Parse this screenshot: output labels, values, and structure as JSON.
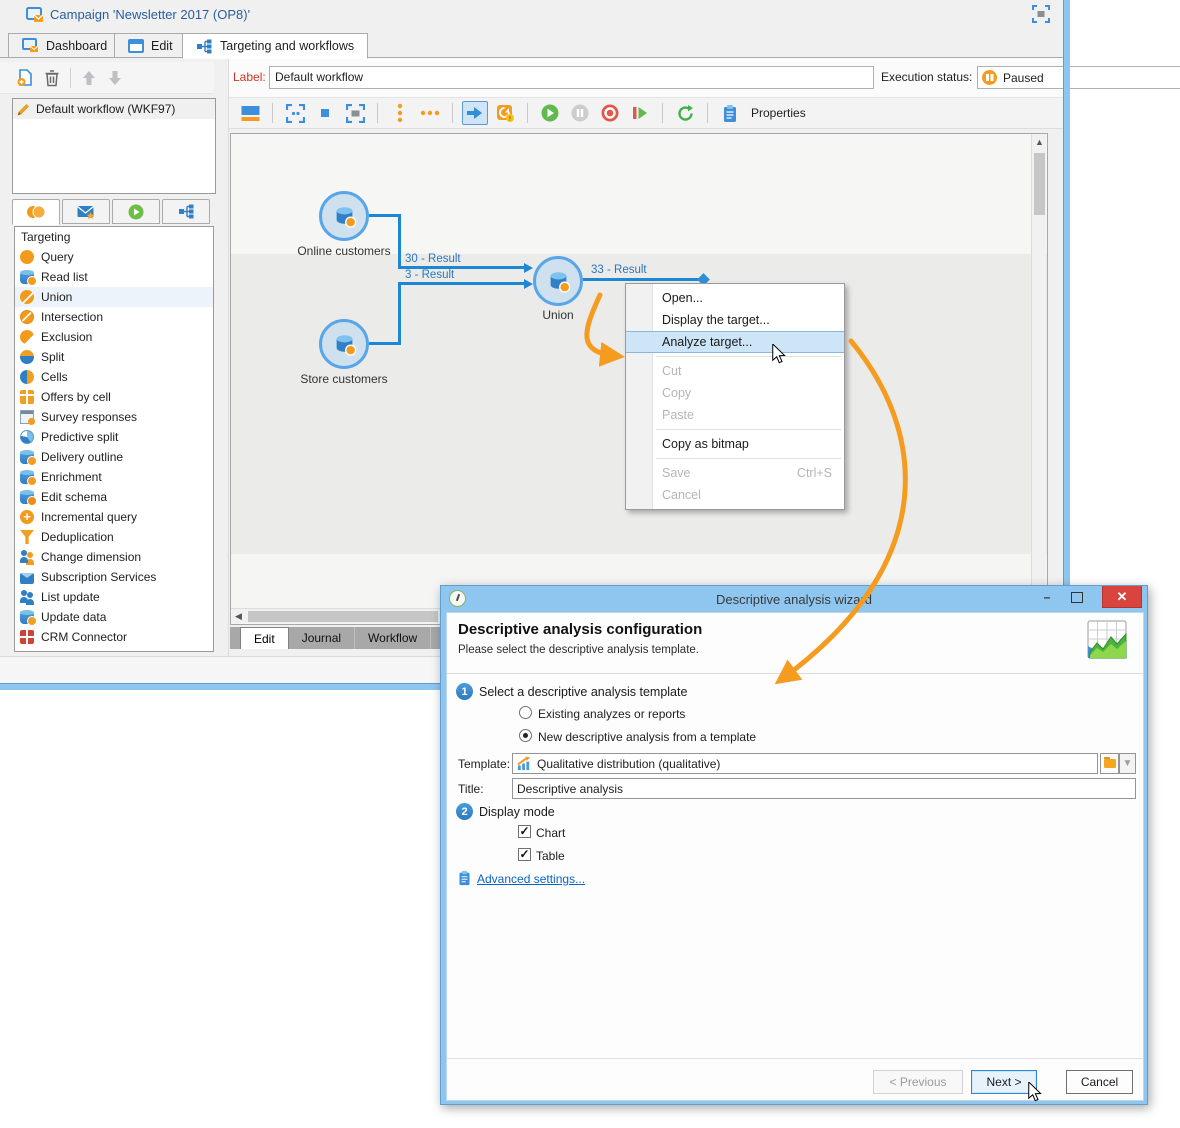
{
  "app": {
    "title": "Campaign 'Newsletter 2017 (OP8)'",
    "tabs": [
      {
        "label": "Dashboard"
      },
      {
        "label": "Edit"
      },
      {
        "label": "Targeting and workflows"
      }
    ]
  },
  "sidebar": {
    "workflows": [
      {
        "label": "Default workflow (WKF97)"
      }
    ],
    "palette": {
      "header": "Targeting",
      "items": [
        {
          "label": "Query",
          "icon": "circle-orange"
        },
        {
          "label": "Read list",
          "icon": "db-person"
        },
        {
          "label": "Union",
          "icon": "circle-union",
          "highlighted": true
        },
        {
          "label": "Intersection",
          "icon": "circle-intersect"
        },
        {
          "label": "Exclusion",
          "icon": "circle-exclude"
        },
        {
          "label": "Split",
          "icon": "split"
        },
        {
          "label": "Cells",
          "icon": "pie"
        },
        {
          "label": "Offers by cell",
          "icon": "offers"
        },
        {
          "label": "Survey responses",
          "icon": "survey"
        },
        {
          "label": "Predictive split",
          "icon": "pie-blue"
        },
        {
          "label": "Delivery outline",
          "icon": "db-mail"
        },
        {
          "label": "Enrichment",
          "icon": "db-star"
        },
        {
          "label": "Edit schema",
          "icon": "db-gear"
        },
        {
          "label": "Incremental query",
          "icon": "circle-plus"
        },
        {
          "label": "Deduplication",
          "icon": "funnel"
        },
        {
          "label": "Change dimension",
          "icon": "people-swap"
        },
        {
          "label": "Subscription Services",
          "icon": "envelope"
        },
        {
          "label": "List update",
          "icon": "people"
        },
        {
          "label": "Update data",
          "icon": "db-refresh"
        },
        {
          "label": "CRM Connector",
          "icon": "crm"
        }
      ]
    }
  },
  "workflow_editor": {
    "label_field": {
      "label": "Label:",
      "value": "Default workflow"
    },
    "execution_status": {
      "label": "Execution status:",
      "value": "Paused"
    },
    "toolbar": {
      "properties_label": "Properties"
    },
    "canvas": {
      "nodes": [
        {
          "label": "Online customers"
        },
        {
          "label": "Store customers"
        },
        {
          "label": "Union"
        }
      ],
      "edges": [
        {
          "label": "30 - Result"
        },
        {
          "label": "3 - Result"
        },
        {
          "label": "33 - Result"
        }
      ]
    },
    "bottom_tabs": [
      {
        "label": "Edit",
        "active": true
      },
      {
        "label": "Journal",
        "active": false
      },
      {
        "label": "Workflow",
        "active": false
      }
    ]
  },
  "context_menu": {
    "items": [
      {
        "label": "Open...",
        "state": "normal"
      },
      {
        "label": "Display the target...",
        "state": "normal"
      },
      {
        "label": "Analyze target...",
        "state": "highlighted"
      },
      {
        "label": "Cut",
        "state": "disabled"
      },
      {
        "label": "Copy",
        "state": "disabled"
      },
      {
        "label": "Paste",
        "state": "disabled"
      },
      {
        "label": "Copy as bitmap",
        "state": "normal"
      },
      {
        "label": "Save",
        "shortcut": "Ctrl+S",
        "state": "disabled"
      },
      {
        "label": "Cancel",
        "state": "disabled"
      }
    ]
  },
  "dialog": {
    "title": "Descriptive analysis wizard",
    "heading": "Descriptive analysis configuration",
    "subheading": "Please select the descriptive analysis template.",
    "step1": {
      "number": "1",
      "label": "Select a descriptive analysis template",
      "options": [
        {
          "label": "Existing analyzes or reports",
          "selected": false
        },
        {
          "label": "New descriptive analysis from a template",
          "selected": true
        }
      ]
    },
    "template_field": {
      "label": "Template:",
      "value": "Qualitative distribution (qualitative)"
    },
    "title_field": {
      "label": "Title:",
      "value": "Descriptive analysis"
    },
    "step2": {
      "number": "2",
      "label": "Display mode",
      "checkboxes": [
        {
          "label": "Chart",
          "checked": true
        },
        {
          "label": "Table",
          "checked": true
        }
      ]
    },
    "advanced_link": "Advanced settings...",
    "buttons": {
      "previous": "< Previous",
      "next": "Next >",
      "cancel": "Cancel"
    }
  },
  "colors": {
    "accent_blue": "#2f8fd8",
    "accent_orange": "#f59b20",
    "status_paused_orange": "#f59b20",
    "dialog_titlebar_blue": "#8fc6f0",
    "close_button_red": "#d9443f",
    "menu_highlight_blue": "#cde6f7"
  }
}
